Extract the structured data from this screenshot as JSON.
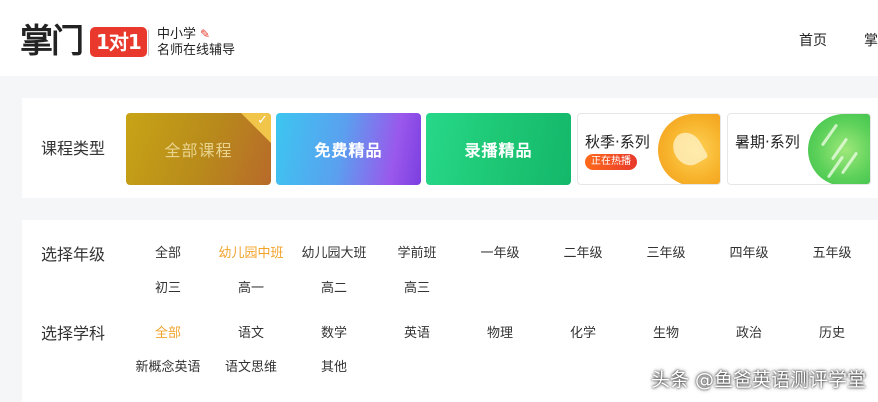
{
  "header": {
    "logo_text": "掌门",
    "logo_badge": "1对1",
    "logo_line1": "中小学",
    "logo_line2": "名师在线辅导",
    "nav": [
      "首页",
      "掌"
    ]
  },
  "course_types": {
    "label": "课程类型",
    "tiles": [
      {
        "label": "全部课程",
        "selected": true
      },
      {
        "label": "免费精品"
      },
      {
        "label": "录播精品"
      },
      {
        "label": "秋季·系列",
        "badge": "正在热播"
      },
      {
        "label": "暑期·系列"
      }
    ]
  },
  "grade": {
    "label": "选择年级",
    "options": [
      "全部",
      "幼儿园中班",
      "幼儿园大班",
      "学前班",
      "一年级",
      "二年级",
      "三年级",
      "四年级",
      "五年级",
      "初三",
      "高一",
      "高二",
      "高三"
    ],
    "selected": "幼儿园中班"
  },
  "subject": {
    "label": "选择学科",
    "options": [
      "全部",
      "语文",
      "数学",
      "英语",
      "物理",
      "化学",
      "生物",
      "政治",
      "历史",
      "新概念英语",
      "语文思维",
      "其他"
    ],
    "selected": "全部"
  },
  "watermark": "头条 @鱼爸英语测评学堂",
  "colors": {
    "accent_orange": "#f2a32a",
    "brand_red": "#e8392c"
  }
}
